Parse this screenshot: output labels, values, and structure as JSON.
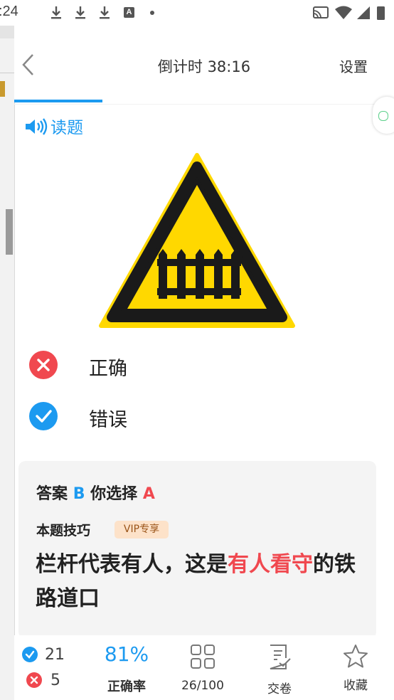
{
  "status_bar": {
    "time": ":24",
    "icons": [
      "download-icon",
      "download-icon",
      "download-icon",
      "font-icon",
      "dot-icon",
      "cast-icon",
      "wifi-icon",
      "signal-icon",
      "battery-icon"
    ]
  },
  "header": {
    "title": "倒计时 38:16",
    "settings_label": "设置"
  },
  "read_aloud": {
    "label": "读题"
  },
  "question": {
    "sign": "railway-crossing-with-gate-warning-sign"
  },
  "options": [
    {
      "label": "正确",
      "state": "wrong"
    },
    {
      "label": "错误",
      "state": "correct"
    }
  ],
  "answer": {
    "prefix": "答案",
    "correct": "B",
    "chosen_prefix": "你选择",
    "chosen": "A",
    "tip_label": "本题技巧",
    "vip_badge": "VIP专享",
    "explain_1": "栏杆代表有人，这是",
    "explain_hl": "有人看守",
    "explain_2": "的铁路道口"
  },
  "bottom": {
    "correct_count": "21",
    "wrong_count": "5",
    "accuracy": "81%",
    "accuracy_label": "正确率",
    "progress_label": "26/100",
    "submit_label": "交卷",
    "favorite_label": "收藏"
  },
  "colors": {
    "accent": "#1c9af0",
    "error": "#f0484f",
    "sign_yellow": "#ffd800"
  }
}
